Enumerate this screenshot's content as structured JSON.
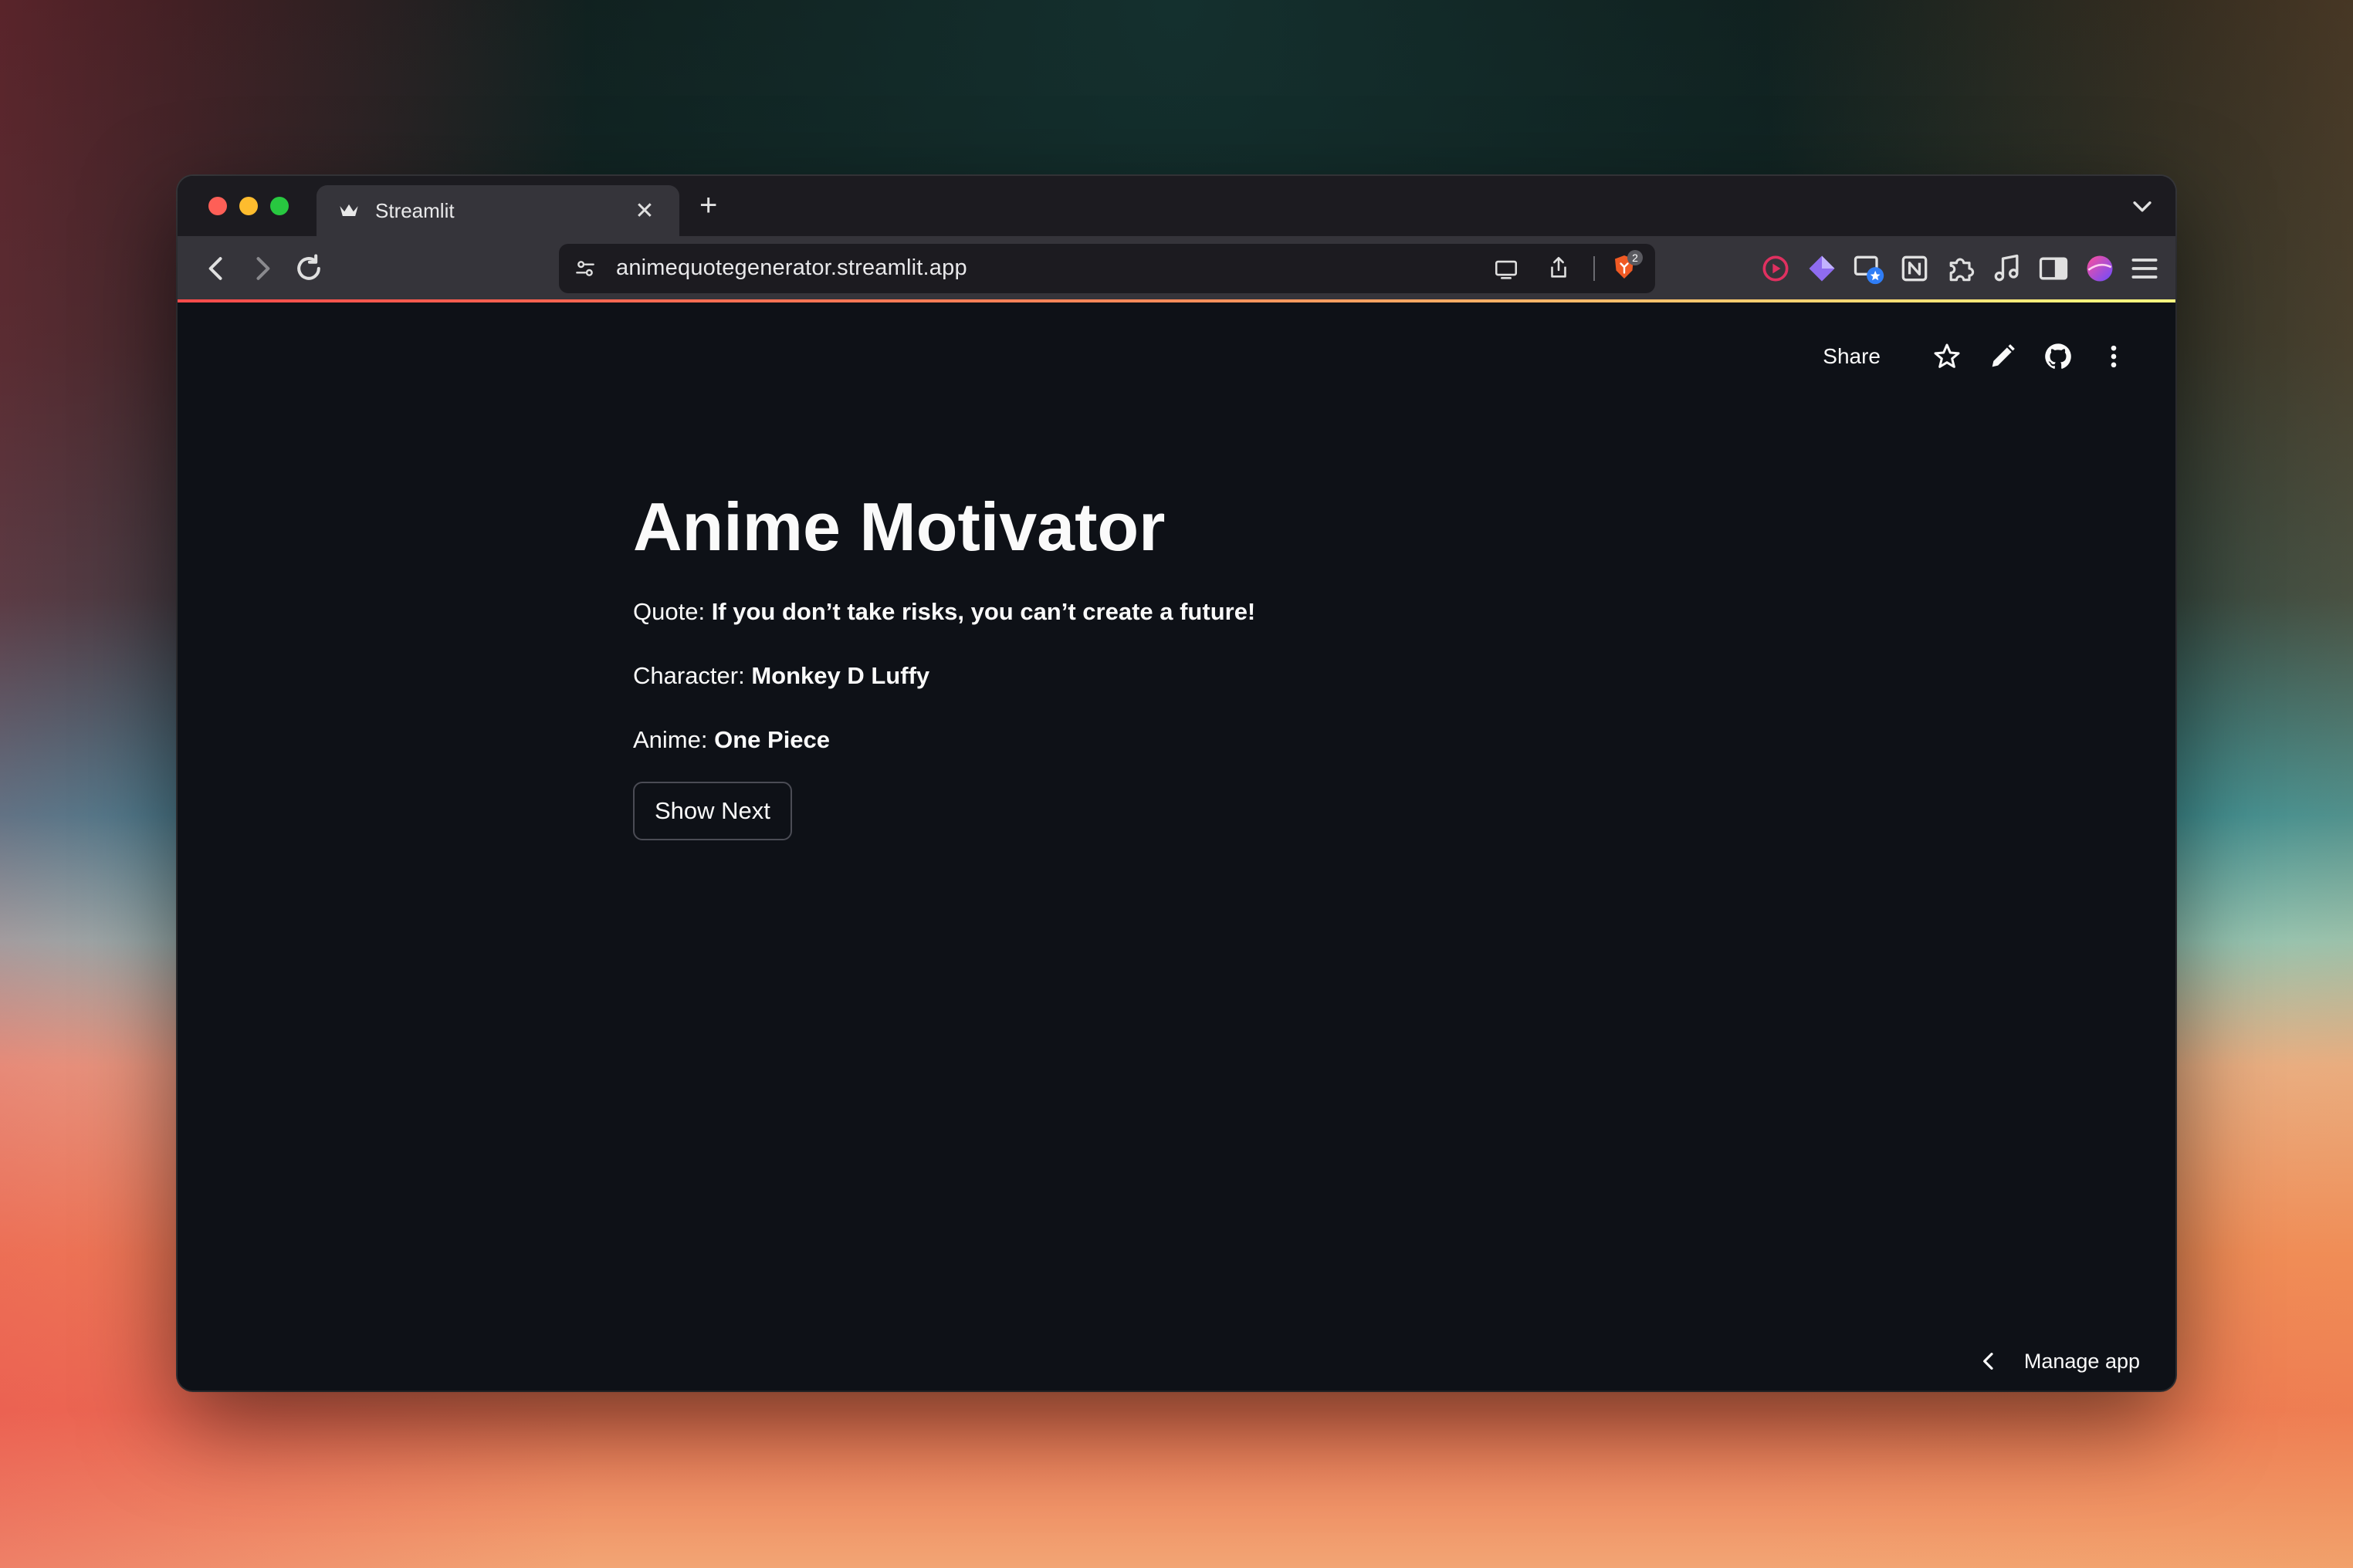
{
  "browser": {
    "tab": {
      "title": "Streamlit",
      "close_glyph": "✕"
    },
    "new_tab_glyph": "+",
    "address": {
      "url": "animequotegenerator.streamlit.app"
    },
    "brave_shields_count": "2"
  },
  "app": {
    "header": {
      "share_label": "Share"
    },
    "title": "Anime Motivator",
    "quote": {
      "label": "Quote: ",
      "value": "If you don’t take risks, you can’t create a future!"
    },
    "character": {
      "label": "Character: ",
      "value": "Monkey D Luffy"
    },
    "anime": {
      "label": "Anime: ",
      "value": "One Piece"
    },
    "show_next_label": "Show Next",
    "manage_app_label": "Manage app"
  },
  "colors": {
    "page_bg": "#0e1117",
    "text": "#fafafa",
    "button_border": "#4b4c55",
    "accent_red": "#ff4b4b"
  },
  "icons": [
    "streamlit-crown-icon",
    "close-icon",
    "plus-icon",
    "chevron-down-icon",
    "back-icon",
    "forward-icon",
    "reload-icon",
    "bookmark-icon",
    "site-settings-icon",
    "cast-icon",
    "share-page-icon",
    "brave-shields-icon",
    "extension-red-play-icon",
    "extension-diamond-icon",
    "extension-window-star-icon",
    "notion-icon",
    "puzzle-icon",
    "music-note-icon",
    "sidebar-icon",
    "profile-icon",
    "menu-icon",
    "star-icon",
    "pencil-icon",
    "github-icon",
    "more-vertical-icon",
    "chevron-left-icon"
  ]
}
